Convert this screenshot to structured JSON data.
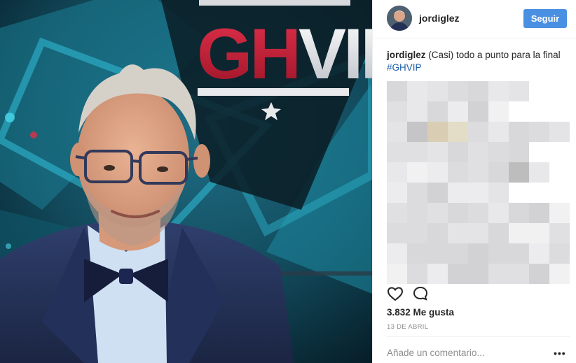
{
  "post": {
    "image": {
      "logo_text": "GHVIP"
    },
    "header": {
      "username": "jordiglez",
      "follow_label": "Seguir"
    },
    "caption": {
      "username": "jordiglez",
      "text": " (Casi) todo a punto para la final ",
      "hashtag": "#GHVIP"
    },
    "likes_text": "3.832 Me gusta",
    "date_text": "13 DE ABRIL",
    "comment_placeholder": "Añade un comentario...",
    "more_options": "•••",
    "icons": {
      "like": "heart-icon",
      "comment": "comment-icon",
      "more": "more-options-icon"
    },
    "colors": {
      "follow_button": "#4a90e2",
      "hashtag": "#1c5fa8",
      "muted_text": "#8e8e8e"
    }
  }
}
